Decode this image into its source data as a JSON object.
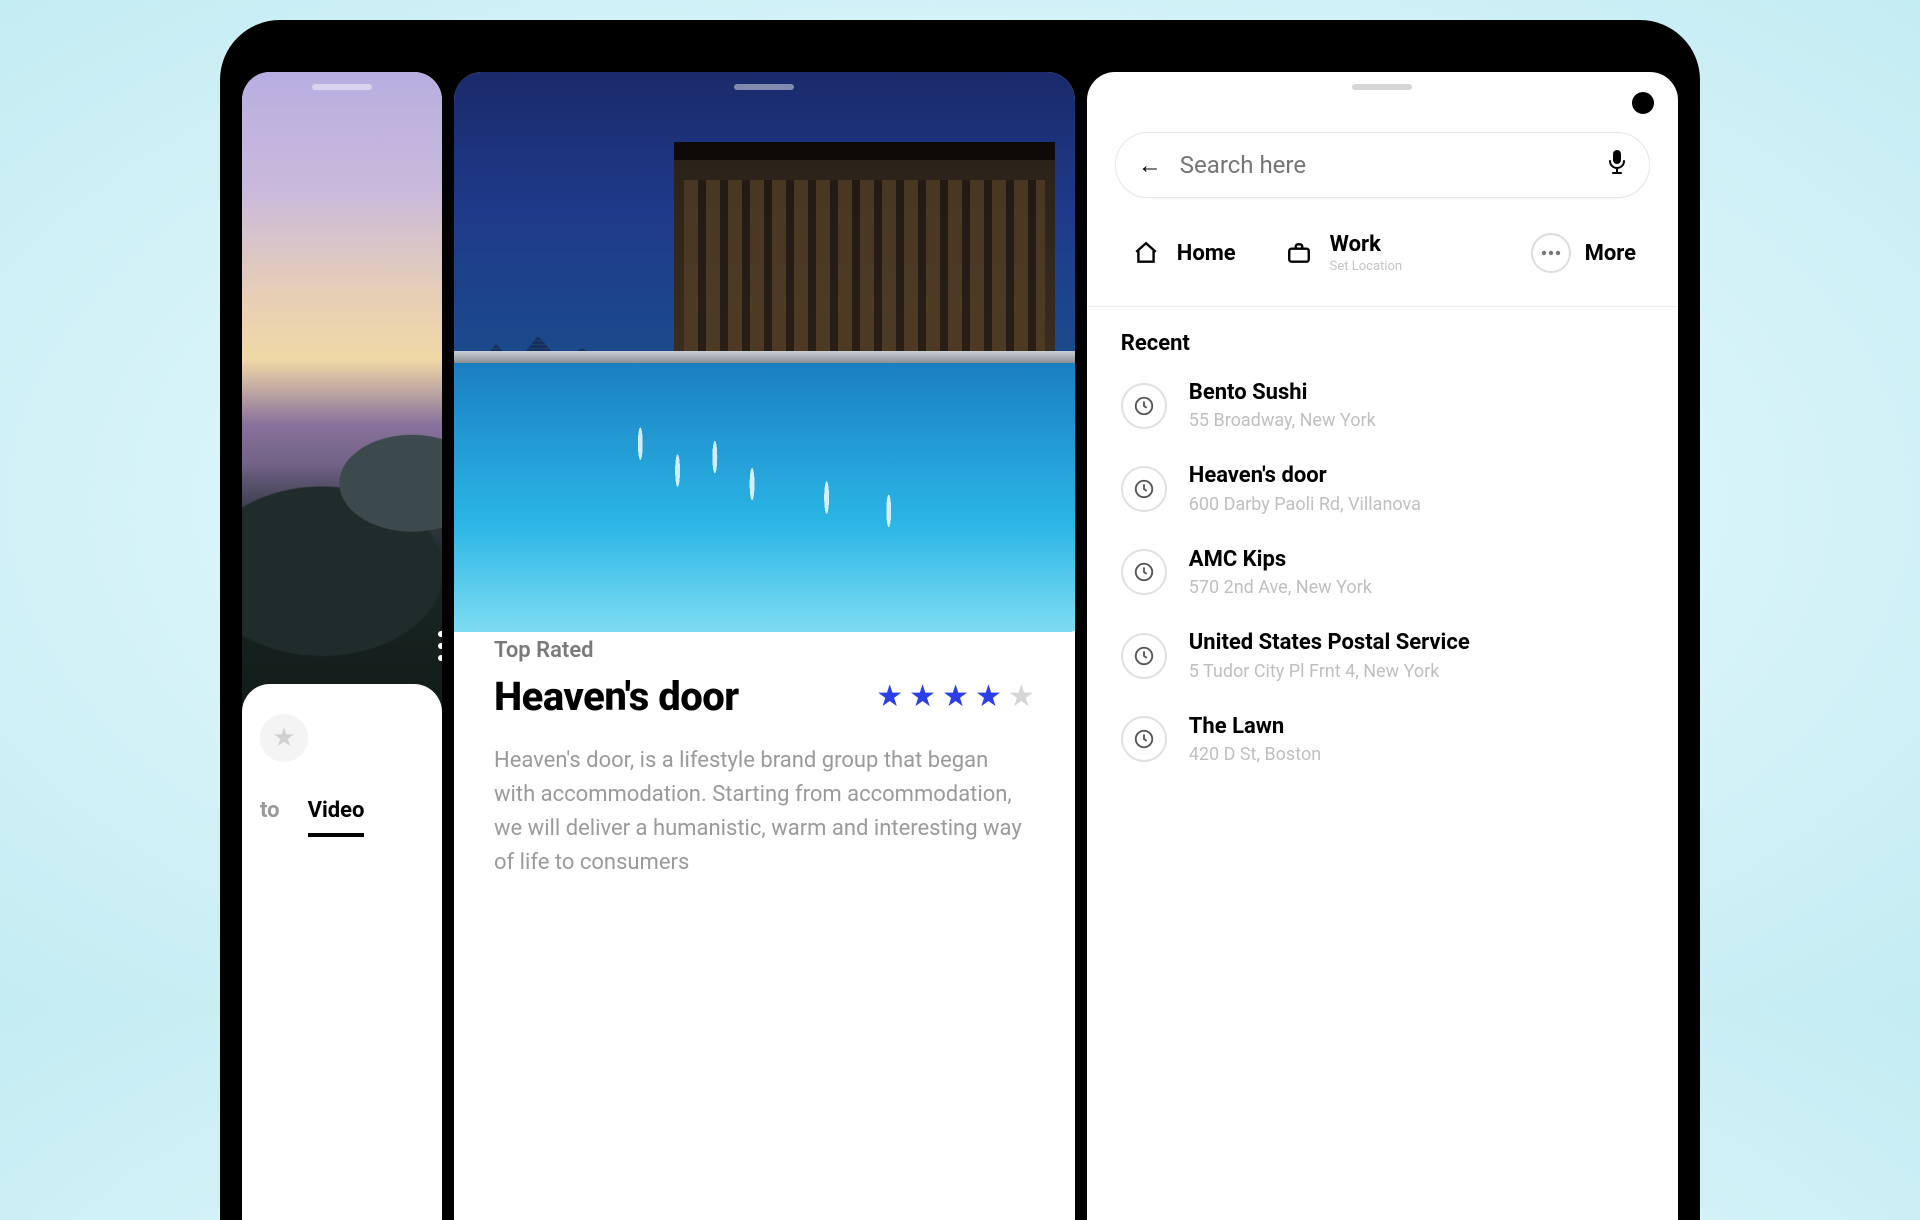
{
  "left": {
    "tabs": {
      "photo": "to",
      "video": "Video"
    }
  },
  "mid": {
    "badge": "Top Rated",
    "title": "Heaven's door",
    "rating": 4,
    "rating_max": 5,
    "description": "Heaven's door, is a lifestyle brand group that began with accommodation. Starting from accommodation, we will deliver a humanistic, warm and interesting way of life to consumers"
  },
  "right": {
    "search_placeholder": "Search here",
    "quick": {
      "home": "Home",
      "work": "Work",
      "work_sub": "Set Location",
      "more": "More"
    },
    "recent_title": "Recent",
    "recent": [
      {
        "name": "Bento Sushi",
        "addr": "55 Broadway, New York"
      },
      {
        "name": "Heaven's door",
        "addr": "600 Darby Paoli Rd, Villanova"
      },
      {
        "name": "AMC Kips",
        "addr": "570 2nd Ave, New York"
      },
      {
        "name": "United States Postal Service",
        "addr": "5 Tudor City Pl Frnt 4, New York"
      },
      {
        "name": "The Lawn",
        "addr": "420 D St, Boston"
      }
    ]
  }
}
